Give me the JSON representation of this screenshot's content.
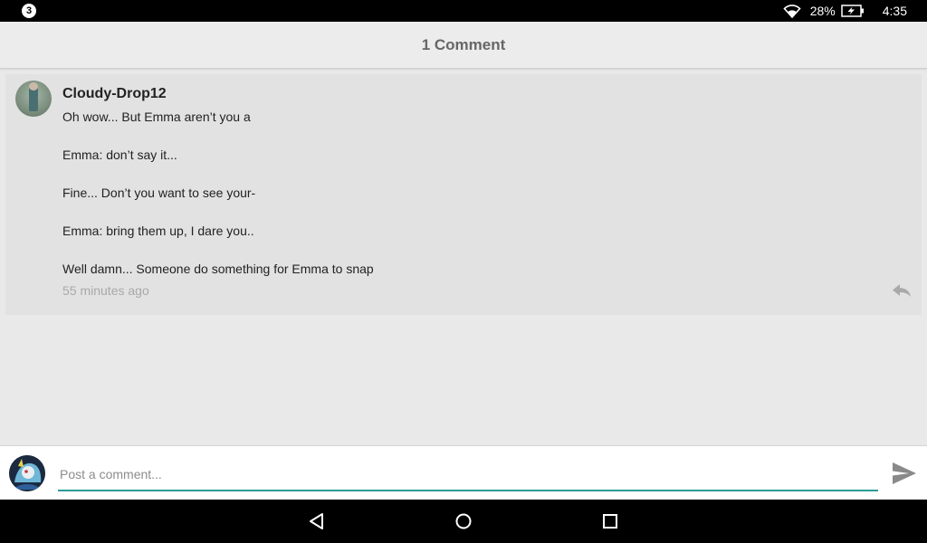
{
  "status_bar": {
    "notification_count": "3",
    "battery_percent": "28%",
    "time": "4:35",
    "icons": [
      "wifi-icon",
      "battery-charging-icon"
    ]
  },
  "header": {
    "title": "1 Comment"
  },
  "comment": {
    "author": "Cloudy-Drop12",
    "lines": [
      "Oh wow... But Emma aren’t you a",
      "Emma: don’t say it...",
      "Fine... Don’t you want to see your-",
      "Emma: bring them up, I dare you..",
      "Well damn... Someone do something for Emma to snap"
    ],
    "timestamp": "55 minutes ago",
    "icons": [
      "avatar",
      "reply-icon"
    ]
  },
  "composer": {
    "placeholder": "Post a comment...",
    "value": "",
    "icons": [
      "user-avatar",
      "send-icon"
    ]
  },
  "nav_bar": {
    "icons": [
      "back-icon",
      "home-icon",
      "recents-icon"
    ]
  },
  "colors": {
    "accent": "#2a9d97",
    "background": "#e9e9e9",
    "card": "#e2e2e2",
    "header_text": "#666666",
    "muted_text": "#a9a9a9"
  }
}
